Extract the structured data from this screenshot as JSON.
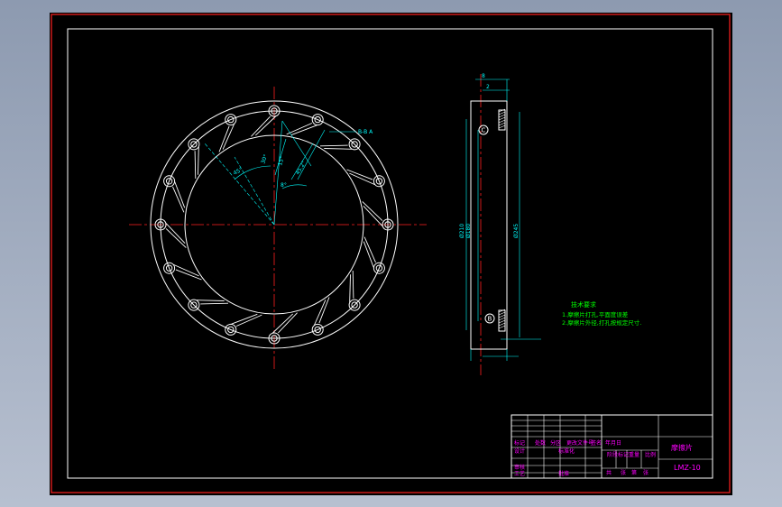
{
  "drawing": {
    "colors": {
      "background": "#000000",
      "outer_frame": "#ff2020",
      "inner_frame": "#ffffff",
      "outline": "#ffffff",
      "center_line": "#ff2020",
      "dimension": "#00ffff",
      "annotation": "#00ff00",
      "title_text": "#ff00ff"
    },
    "front_view": {
      "hole_count": 16,
      "dimension_labels": [
        "45°",
        "30°",
        "8°",
        "15°",
        "45.2°"
      ],
      "leader_label": "B-B A"
    },
    "side_view": {
      "callouts": [
        "C",
        "B"
      ],
      "dimension_labels": [
        "Ø180",
        "Ø210",
        "Ø245",
        "8",
        "2"
      ]
    },
    "notes": {
      "heading": "技术要求",
      "lines": [
        "1.摩擦片打孔,平面度误差",
        "2.摩擦片外径,打孔按规定尺寸."
      ]
    },
    "title_block": {
      "part_name": "摩擦片",
      "drawing_no": "LMZ-10",
      "labels": [
        "标记",
        "处数",
        "分区",
        "更改文件号",
        "签名",
        "年月日",
        "设计",
        "标准化",
        "审核",
        "工艺",
        "批准",
        "阶段标记",
        "重量",
        "比例",
        "共",
        "张",
        "第",
        "张"
      ]
    }
  }
}
